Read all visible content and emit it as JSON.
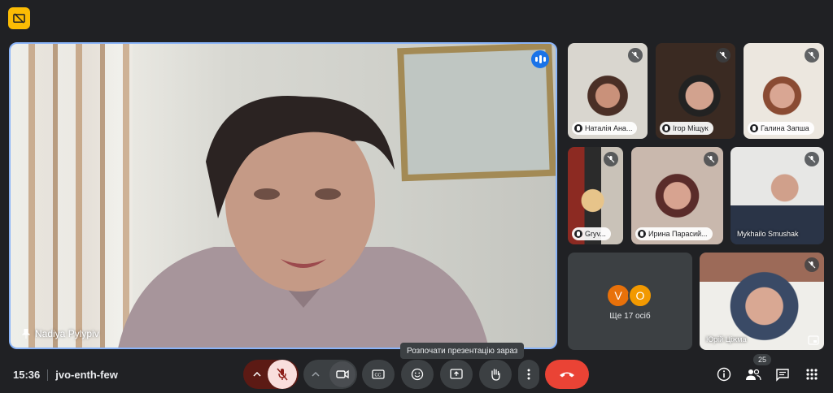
{
  "main_speaker": {
    "name": "Nadiya Pylypiv"
  },
  "participants": [
    {
      "name": "Наталія Ана...",
      "muted": true
    },
    {
      "name": "Ігор Міщук",
      "muted": true
    },
    {
      "name": "Галина Запша",
      "muted": true
    },
    {
      "name": "Gryv...",
      "muted": true
    },
    {
      "name": "Ирина Парасий...",
      "muted": true
    },
    {
      "name": "Mykhailo Smushak",
      "muted": true
    },
    {
      "name": "Юрій Ціжма",
      "muted": true
    }
  ],
  "more": {
    "avatars": [
      "V",
      "O"
    ],
    "avatar_colors": [
      "#e8710a",
      "#f29900"
    ],
    "text": "Ще 17 осіб"
  },
  "tooltip": "Розпочати презентацію зараз",
  "meeting": {
    "time": "15:36",
    "code": "jvo-enth-few"
  },
  "people_count": "25",
  "colors": {
    "accent": "#8ab4f8",
    "end_call": "#ea4335",
    "mic_muted_bg": "#f9dedc"
  }
}
